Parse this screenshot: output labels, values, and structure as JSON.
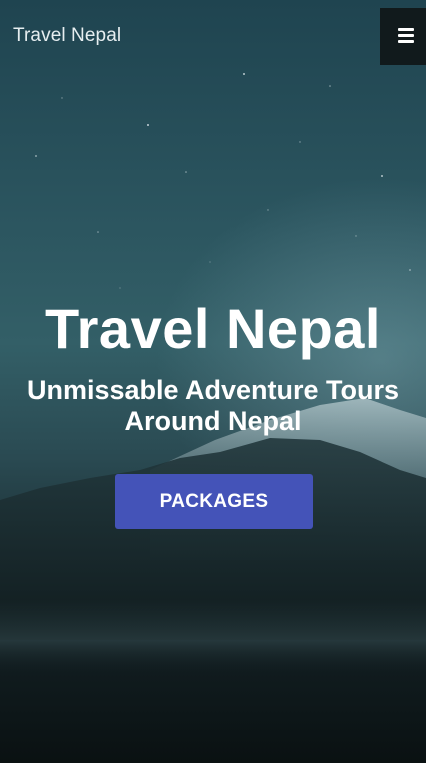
{
  "navbar": {
    "brand": "Travel Nepal",
    "menu_icon": "hamburger-menu-icon"
  },
  "hero": {
    "title": "Travel Nepal",
    "subtitle": "Unmissable Adventure Tours Around Nepal",
    "button_label": "PACKAGES",
    "background_image": "starry night sky over snow-capped mountains"
  },
  "colors": {
    "accent": "#4453b8",
    "menu_bg": "#111a1c",
    "text": "#ffffff"
  }
}
